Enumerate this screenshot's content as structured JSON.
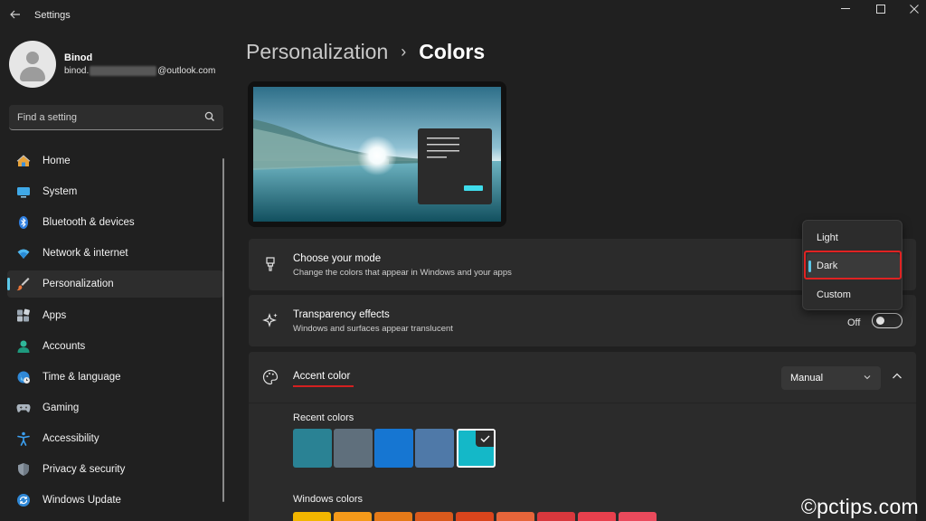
{
  "window": {
    "title": "Settings",
    "controls": [
      "—",
      "☐",
      "✕"
    ]
  },
  "user": {
    "name": "Binod",
    "email_prefix": "binod.",
    "email_suffix": "@outlook.com"
  },
  "search": {
    "placeholder": "Find a setting"
  },
  "sidebar": {
    "items": [
      {
        "label": "Home",
        "icon": "home-icon",
        "selected": false
      },
      {
        "label": "System",
        "icon": "system-icon",
        "selected": false
      },
      {
        "label": "Bluetooth & devices",
        "icon": "bluetooth-icon",
        "selected": false
      },
      {
        "label": "Network & internet",
        "icon": "wifi-icon",
        "selected": false
      },
      {
        "label": "Personalization",
        "icon": "brush-icon",
        "selected": true
      },
      {
        "label": "Apps",
        "icon": "apps-icon",
        "selected": false
      },
      {
        "label": "Accounts",
        "icon": "accounts-icon",
        "selected": false
      },
      {
        "label": "Time & language",
        "icon": "globe-icon",
        "selected": false
      },
      {
        "label": "Gaming",
        "icon": "gamepad-icon",
        "selected": false
      },
      {
        "label": "Accessibility",
        "icon": "accessibility-icon",
        "selected": false
      },
      {
        "label": "Privacy & security",
        "icon": "shield-icon",
        "selected": false
      },
      {
        "label": "Windows Update",
        "icon": "update-icon",
        "selected": false
      }
    ]
  },
  "breadcrumb": {
    "parent": "Personalization",
    "separator": "›",
    "current": "Colors"
  },
  "mode_card": {
    "title": "Choose your mode",
    "subtitle": "Change the colors that appear in Windows and your apps"
  },
  "mode_menu": {
    "options": [
      "Light",
      "Dark",
      "Custom"
    ],
    "selected": "Dark"
  },
  "transparency_card": {
    "title": "Transparency effects",
    "subtitle": "Windows and surfaces appear translucent",
    "toggle_label": "Off",
    "toggle_on": false
  },
  "accent_card": {
    "title": "Accent color",
    "dropdown_value": "Manual",
    "recent_colors_label": "Recent colors",
    "recent_colors": [
      "#2a8294",
      "#5f6f7c",
      "#1676d2",
      "#4f79a8",
      "#14b8c8"
    ],
    "selected_recent_index": 4,
    "windows_colors_label": "Windows colors",
    "windows_colors": [
      "#f2b600",
      "#f59a1a",
      "#e57a18",
      "#d95a1c",
      "#d9451c",
      "#e6653a",
      "#d8383d",
      "#e8404d",
      "#ea4a5c"
    ]
  },
  "watermark": "©pctips.com",
  "colors": {
    "accent": "#5cc8e8",
    "highlight_red": "#e02222",
    "background": "#202020",
    "card": "#2b2b2b"
  }
}
